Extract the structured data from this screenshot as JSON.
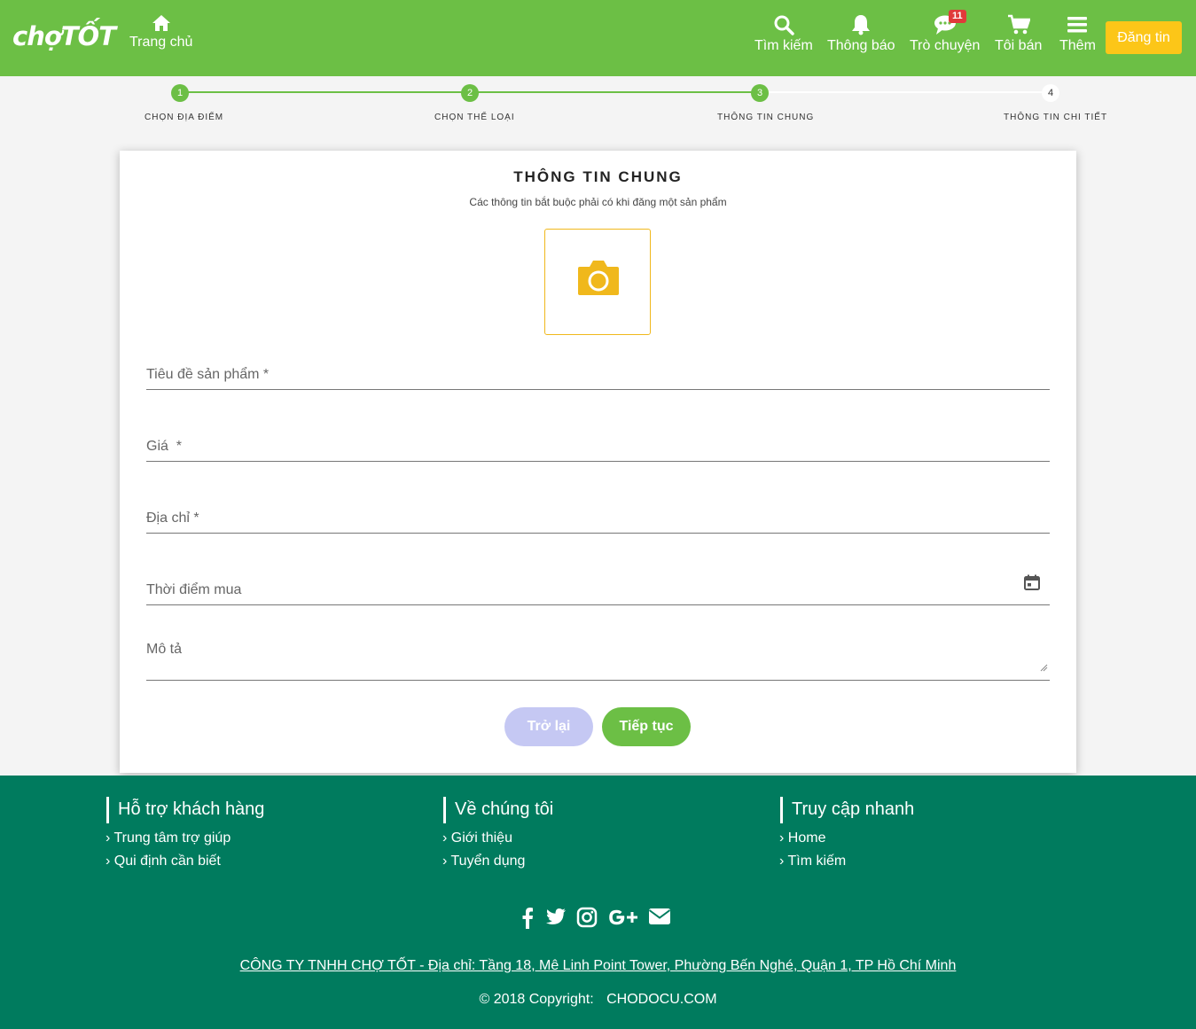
{
  "header": {
    "logo": "chợTỐT",
    "home_label": "Trang chủ",
    "search_label": "Tìm kiếm",
    "notify_label": "Thông báo",
    "chat_label": "Trò chuyện",
    "chat_badge": "11",
    "sell_label": "Tôi bán",
    "more_label": "Thêm",
    "post_button": "Đăng tin"
  },
  "stepper": {
    "steps": [
      {
        "number": "1",
        "label": "Chọn địa điểm",
        "done": true
      },
      {
        "number": "2",
        "label": "Chọn thể loại",
        "done": true
      },
      {
        "number": "3",
        "label": "Thông tin chung",
        "done": true
      },
      {
        "number": "4",
        "label": "Thông tin chi tiết",
        "done": false
      }
    ]
  },
  "form": {
    "title": "THÔNG TIN CHUNG",
    "subtitle": "Các thông tin bắt buộc phải có khi đăng một sản phẩm",
    "fields": {
      "title": "Tiêu đề sản phẩm *",
      "price": "Giá  *",
      "address": "Địa chỉ *",
      "purchase_time": "Thời điểm mua",
      "description": "Mô tả"
    },
    "back_button": "Trở lại",
    "next_button": "Tiếp tục"
  },
  "footer": {
    "columns": [
      {
        "title": "Hỗ trợ khách hàng",
        "links": [
          "Trung tâm trợ giúp",
          "Qui định cần biết"
        ]
      },
      {
        "title": "Về chúng tôi",
        "links": [
          "Giới thiệu",
          "Tuyển dụng"
        ]
      },
      {
        "title": "Truy cập nhanh",
        "links": [
          "Home",
          "Tìm kiếm"
        ]
      }
    ],
    "address": "CÔNG TY TNHH CHỢ TỐT - Địa chỉ: Tầng 18, Mê Linh Point Tower, Phường Bến Nghé, Quận 1, TP Hồ Chí Minh",
    "copyright": "© 2018 Copyright:",
    "site": "CHODOCU.COM",
    "link_prefix": "›"
  },
  "colors": {
    "brand_green": "#6cbf45",
    "footer_green": "#007b5e",
    "accent_yellow": "#fcc618",
    "camera_yellow": "#f0b81c",
    "back_button": "#c5c8f3",
    "badge_red": "#e03a3a"
  },
  "icons": [
    "home-icon",
    "search-icon",
    "bell-icon",
    "chat-icon",
    "cart-icon",
    "menu-icon",
    "camera-icon",
    "calendar-icon",
    "resize-icon",
    "facebook-icon",
    "twitter-icon",
    "instagram-icon",
    "google-plus-icon",
    "mail-icon"
  ]
}
